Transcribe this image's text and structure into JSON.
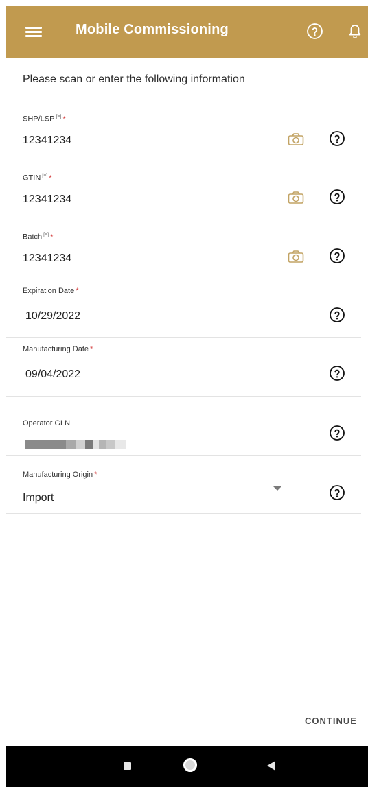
{
  "app_bar": {
    "title": "Mobile Commissioning",
    "background_color": "#c19a4f",
    "menu_icon": "hamburger-menu-icon",
    "help_icon": "help-circle-icon",
    "notification_icon": "bell-icon"
  },
  "intro_text": "Please scan or enter the following information",
  "fields": [
    {
      "label": "SHP/LSP",
      "scan_badge": "[≡]",
      "required_mark": "*",
      "value": "12341234",
      "camera_icon": "camera-icon",
      "help_icon": "help-circle-icon"
    },
    {
      "label": "GTIN",
      "scan_badge": "[≡]",
      "required_mark": "*",
      "value": "12341234",
      "camera_icon": "camera-icon",
      "help_icon": "help-circle-icon"
    },
    {
      "label": "Batch",
      "scan_badge": "[≡]",
      "required_mark": "*",
      "value": "12341234",
      "camera_icon": "camera-icon",
      "help_icon": "help-circle-icon"
    },
    {
      "label": "Expiration Date",
      "required_mark": "*",
      "value": "10/29/2022",
      "help_icon": "help-circle-icon"
    },
    {
      "label": "Manufacturing Date",
      "required_mark": "*",
      "value": "09/04/2022",
      "help_icon": "help-circle-icon"
    },
    {
      "label": "Operator GLN",
      "value_redacted": true,
      "help_icon": "help-circle-icon"
    },
    {
      "label": "Manufacturing Origin",
      "required_mark": "*",
      "value": "Import",
      "dropdown_icon": "dropdown-arrow-icon",
      "help_icon": "help-circle-icon"
    }
  ],
  "continue_label": "CONTINUE",
  "colors": {
    "accent": "#c19a4f",
    "required": "#d64545",
    "camera_icon": "#c2a364"
  },
  "system_nav": {
    "recents_icon": "square-recents-icon",
    "home_icon": "circle-home-icon",
    "back_icon": "triangle-back-icon"
  }
}
